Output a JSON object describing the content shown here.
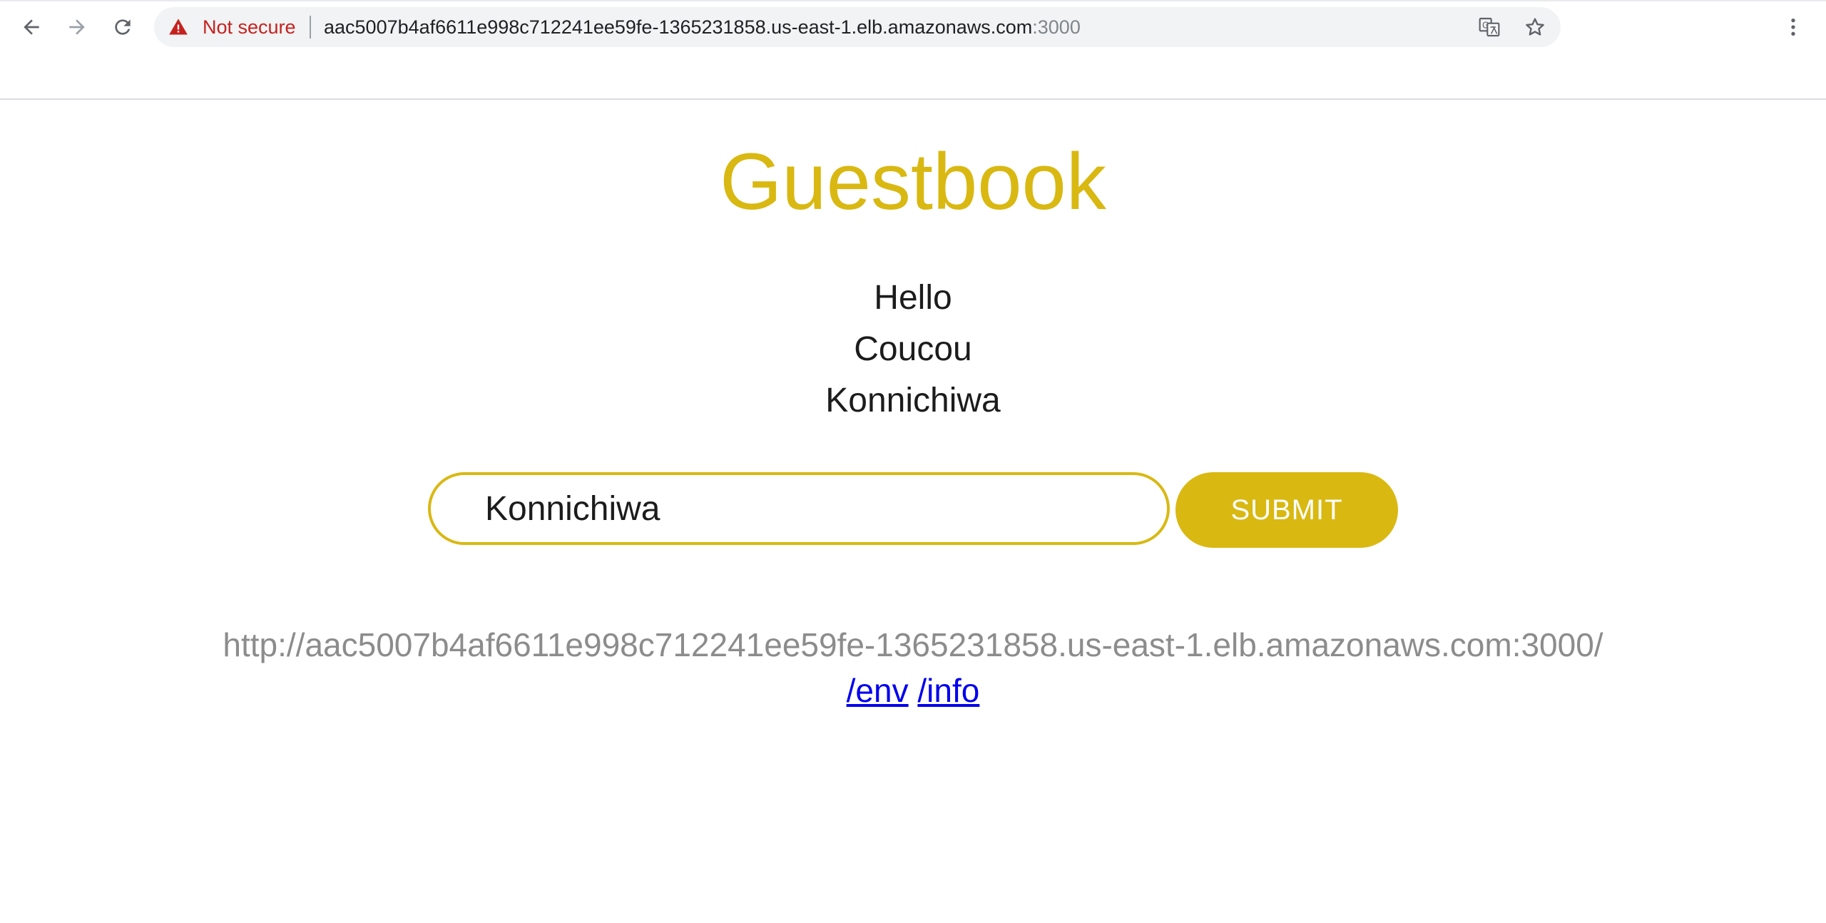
{
  "browser": {
    "security_label": "Not secure",
    "url_host": "aac5007b4af6611e998c712241ee59fe-1365231858.us-east-1.elb.amazonaws.com",
    "url_port": ":3000",
    "icons": {
      "back": "arrow-left-icon",
      "forward": "arrow-right-icon",
      "reload": "reload-icon",
      "warning": "warning-triangle-icon",
      "translate": "translate-icon",
      "bookmark": "star-icon",
      "menu": "kebab-menu-icon"
    }
  },
  "page": {
    "title": "Guestbook",
    "entries": [
      "Hello",
      "Coucou",
      "Konnichiwa"
    ],
    "input": {
      "value": "Konnichiwa"
    },
    "submit_label": "SUBMIT",
    "host_url": "http://aac5007b4af6611e998c712241ee59fe-1365231858.us-east-1.elb.amazonaws.com:3000/",
    "links": [
      {
        "label": "/env"
      },
      {
        "label": "/info"
      }
    ]
  },
  "colors": {
    "accent": "#d9b812",
    "not_secure": "#c5221f",
    "link": "#0000ee",
    "muted_text": "#8c8c8c"
  }
}
